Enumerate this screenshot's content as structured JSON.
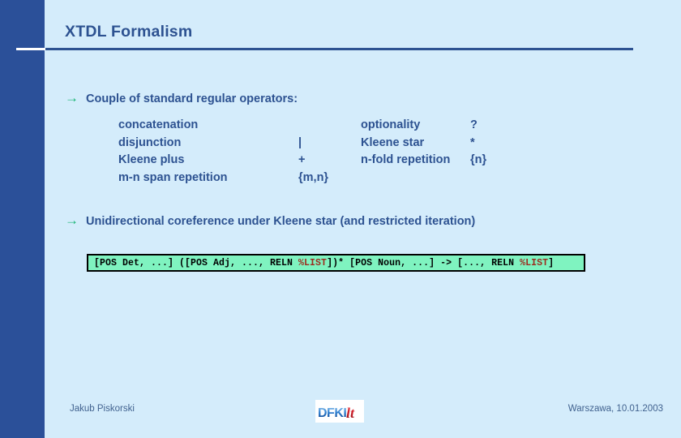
{
  "slide": {
    "title": "XTDL Formalism",
    "background_color": "#d4ecfb",
    "sidebar_color": "#2b5099",
    "title_color": "#2d5291",
    "bullet_arrow_color": "#18b573"
  },
  "bullets": [
    {
      "arrow": "→",
      "text": "Couple of standard regular operators:"
    },
    {
      "arrow": "→",
      "text": "Unidirectional coreference under Kleene star (and restricted iteration)"
    }
  ],
  "operators": {
    "rows": [
      {
        "name_left": "concatenation",
        "symbol_left": "",
        "name_right": "optionality",
        "symbol_right": "?"
      },
      {
        "name_left": "disjunction",
        "symbol_left": "|",
        "name_right": "Kleene star",
        "symbol_right": "*"
      },
      {
        "name_left": "Kleene plus",
        "symbol_left": "+",
        "name_right": "n-fold repetition",
        "symbol_right": "{n}"
      },
      {
        "name_left": "m-n span repetition",
        "symbol_left": "{m,n}",
        "name_right": "",
        "symbol_right": ""
      }
    ]
  },
  "code_box": {
    "background_color": "#7ff3c0",
    "border_color": "#000000",
    "text_color": "#000000",
    "highlight_color": "#9c2b1e",
    "full_text": "[POS Det, ...] ([POS Adj, ..., RELN %LIST])* [POS Noun, ...] -> [..., RELN %LIST]",
    "segments": [
      {
        "text": "[POS Det, ...] ([POS Adj, ..., RELN ",
        "highlight": false
      },
      {
        "text": "%LIST",
        "highlight": true
      },
      {
        "text": "])* [POS Noun, ...] -> [..., RELN ",
        "highlight": false
      },
      {
        "text": "%LIST",
        "highlight": true
      },
      {
        "text": "]",
        "highlight": false
      }
    ]
  },
  "footer": {
    "author": "Jakub Piskorski",
    "date": "Warszawa, 10.01.2003",
    "logo_text": "DFKI",
    "logo_mark": "lt",
    "logo_blue": "#1b5bb0",
    "logo_red": "#d31f2a"
  }
}
